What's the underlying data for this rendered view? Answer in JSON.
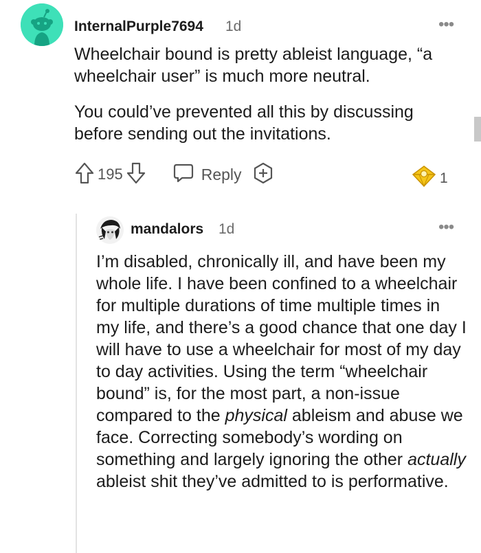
{
  "comment": {
    "username": "InternalPurple7694",
    "timestamp": "1d",
    "more_label": "•••",
    "paragraphs": [
      "Wheelchair bound is pretty ableist language, “a wheelchair user” is much more neutral.",
      "You could’ve prevented all this by discussing before sending out the invitations."
    ],
    "vote_count": "195",
    "reply_label": "Reply",
    "award_count": "1"
  },
  "reply": {
    "username": "mandalors",
    "timestamp": "1d",
    "more_label": "•••",
    "body": {
      "s1": "I’m disabled, chronically ill, and have been my whole life. I have been confined to a wheelchair for multiple durations of time multiple times in my life, and there’s a good chance that one day I will have to use a wheelchair for most of my day to day activities. Using the term “wheelchair bound” is, for the most part, a non-issue compared to the ",
      "em1": "physical",
      "s2": " ableism and abuse we face. Correcting somebody’s wording on something and largely ignoring the other ",
      "em2": "actually",
      "s3": " ableist shit they’ve admitted to is performative."
    }
  },
  "colors": {
    "avatar_bg": "#3ee0b8",
    "text": "#1c1c1c",
    "meta": "#6b6b6b",
    "award_gold": "#f5c518"
  },
  "icons": [
    "reddit-snoo-avatar",
    "upvote-icon",
    "downvote-icon",
    "reply-icon",
    "award-icon",
    "gold-award-icon",
    "more-options-icon"
  ]
}
